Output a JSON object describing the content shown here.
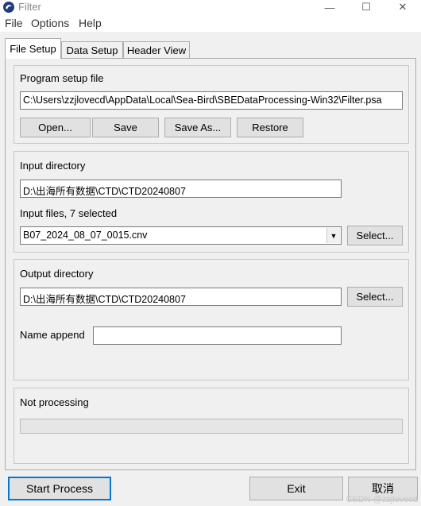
{
  "window": {
    "title": "Filter",
    "app_icon": "seabird-logo-icon",
    "controls": {
      "minimize": "—",
      "maximize": "☐",
      "close": "✕"
    }
  },
  "menu": [
    "File",
    "Options",
    "Help"
  ],
  "tabs": [
    {
      "label": "File Setup",
      "active": true
    },
    {
      "label": "Data Setup",
      "active": false
    },
    {
      "label": "Header View",
      "active": false
    }
  ],
  "program_setup": {
    "heading": "Program setup file",
    "path": "C:\\Users\\zzjlovecd\\AppData\\Local\\Sea-Bird\\SBEDataProcessing-Win32\\Filter.psa",
    "buttons": {
      "open": "Open...",
      "save": "Save",
      "save_as": "Save As...",
      "restore": "Restore"
    }
  },
  "input": {
    "dir_heading": "Input directory",
    "dir_path": "D:\\出海所有数据\\CTD\\CTD20240807",
    "files_heading": "Input files, 7 selected",
    "selected_file": "B07_2024_08_07_0015.cnv",
    "select_label": "Select..."
  },
  "output": {
    "dir_heading": "Output directory",
    "dir_path": "D:\\出海所有数据\\CTD\\CTD20240807",
    "select_label": "Select...",
    "name_append_label": "Name append",
    "name_append_value": ""
  },
  "status": {
    "text": "Not processing",
    "progress": 0
  },
  "bottom": {
    "start": "Start Process",
    "exit": "Exit",
    "cancel": "取消"
  },
  "watermark": "CSDN @zzjlovecd",
  "colors": {
    "progress_fill": "#06b025",
    "accent": "#0078d7"
  }
}
